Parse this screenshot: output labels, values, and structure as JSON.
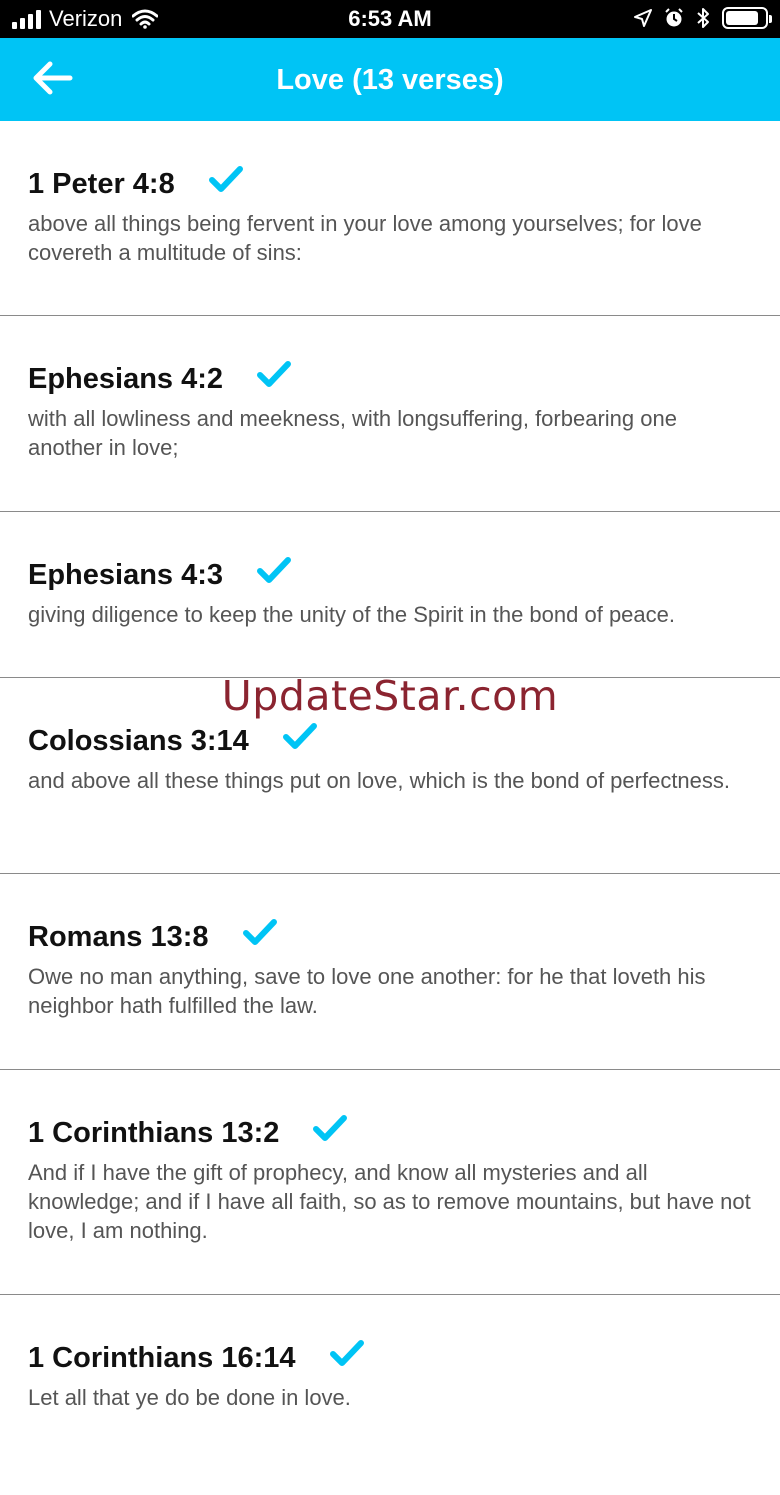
{
  "status_bar": {
    "carrier": "Verizon",
    "time": "6:53 AM",
    "battery_level": 0.85
  },
  "header": {
    "title": "Love (13 verses)",
    "back_icon": "arrow-left-icon"
  },
  "accent_color": "#00c4f5",
  "verses": [
    {
      "reference": "1 Peter 4:8",
      "text": "above all things being fervent in your love among yourselves; for love covereth a multitude of sins:"
    },
    {
      "reference": "Ephesians 4:2",
      "text": "with all lowliness and meekness, with longsuffering, forbearing one another in love;"
    },
    {
      "reference": "Ephesians 4:3",
      "text": "giving diligence to keep the unity of the Spirit in the bond of peace."
    },
    {
      "reference": "Colossians 3:14",
      "text": "and above all these things put on love, which is the bond of perfectness."
    },
    {
      "reference": "Romans 13:8",
      "text": "Owe no man anything, save to love one another: for he that loveth his neighbor hath fulfilled the law."
    },
    {
      "reference": "1 Corinthians 13:2",
      "text": "And if I have the gift of prophecy, and know all mysteries and all knowledge; and if I have all faith, so as to remove mountains, but have not love, I am nothing."
    },
    {
      "reference": "1 Corinthians 16:14",
      "text": "Let all that ye do be done in love."
    }
  ],
  "watermark": "UpdateStar.com"
}
